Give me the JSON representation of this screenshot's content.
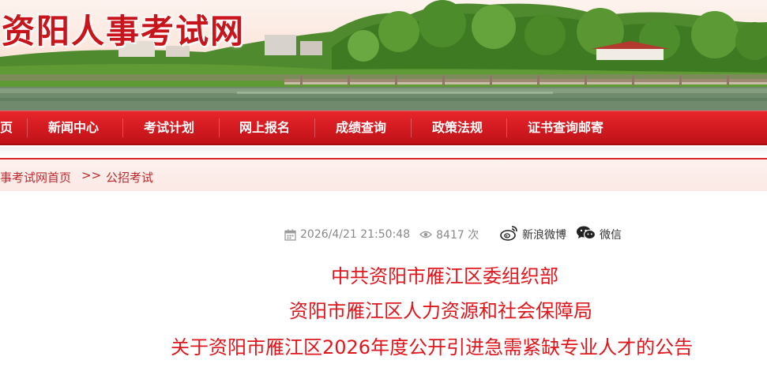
{
  "site": {
    "title": "资阳人事考试网"
  },
  "nav": {
    "items": [
      {
        "label": "页"
      },
      {
        "label": "新闻中心"
      },
      {
        "label": "考试计划"
      },
      {
        "label": "网上报名"
      },
      {
        "label": "成绩查询"
      },
      {
        "label": "政策法规"
      },
      {
        "label": "证书查询邮寄"
      }
    ]
  },
  "breadcrumb": {
    "home": "事考试网首页",
    "separator": ">>",
    "current": "公招考试"
  },
  "article": {
    "date": "2026/4/21 21:50:48",
    "views": "8417 次",
    "share_weibo": "新浪微博",
    "share_wechat": "微信",
    "title_lines": [
      "中共资阳市雁江区委组织部",
      "资阳市雁江区人力资源和社会保障局",
      "关于资阳市雁江区2026年度公开引进急需紧缺专业人才的公告"
    ]
  },
  "colors": {
    "brand_red": "#d11a20",
    "title_red": "#e0161d",
    "meta_gray": "#888888"
  },
  "icons": [
    "calendar-icon",
    "eye-icon",
    "weibo-icon",
    "wechat-icon"
  ]
}
